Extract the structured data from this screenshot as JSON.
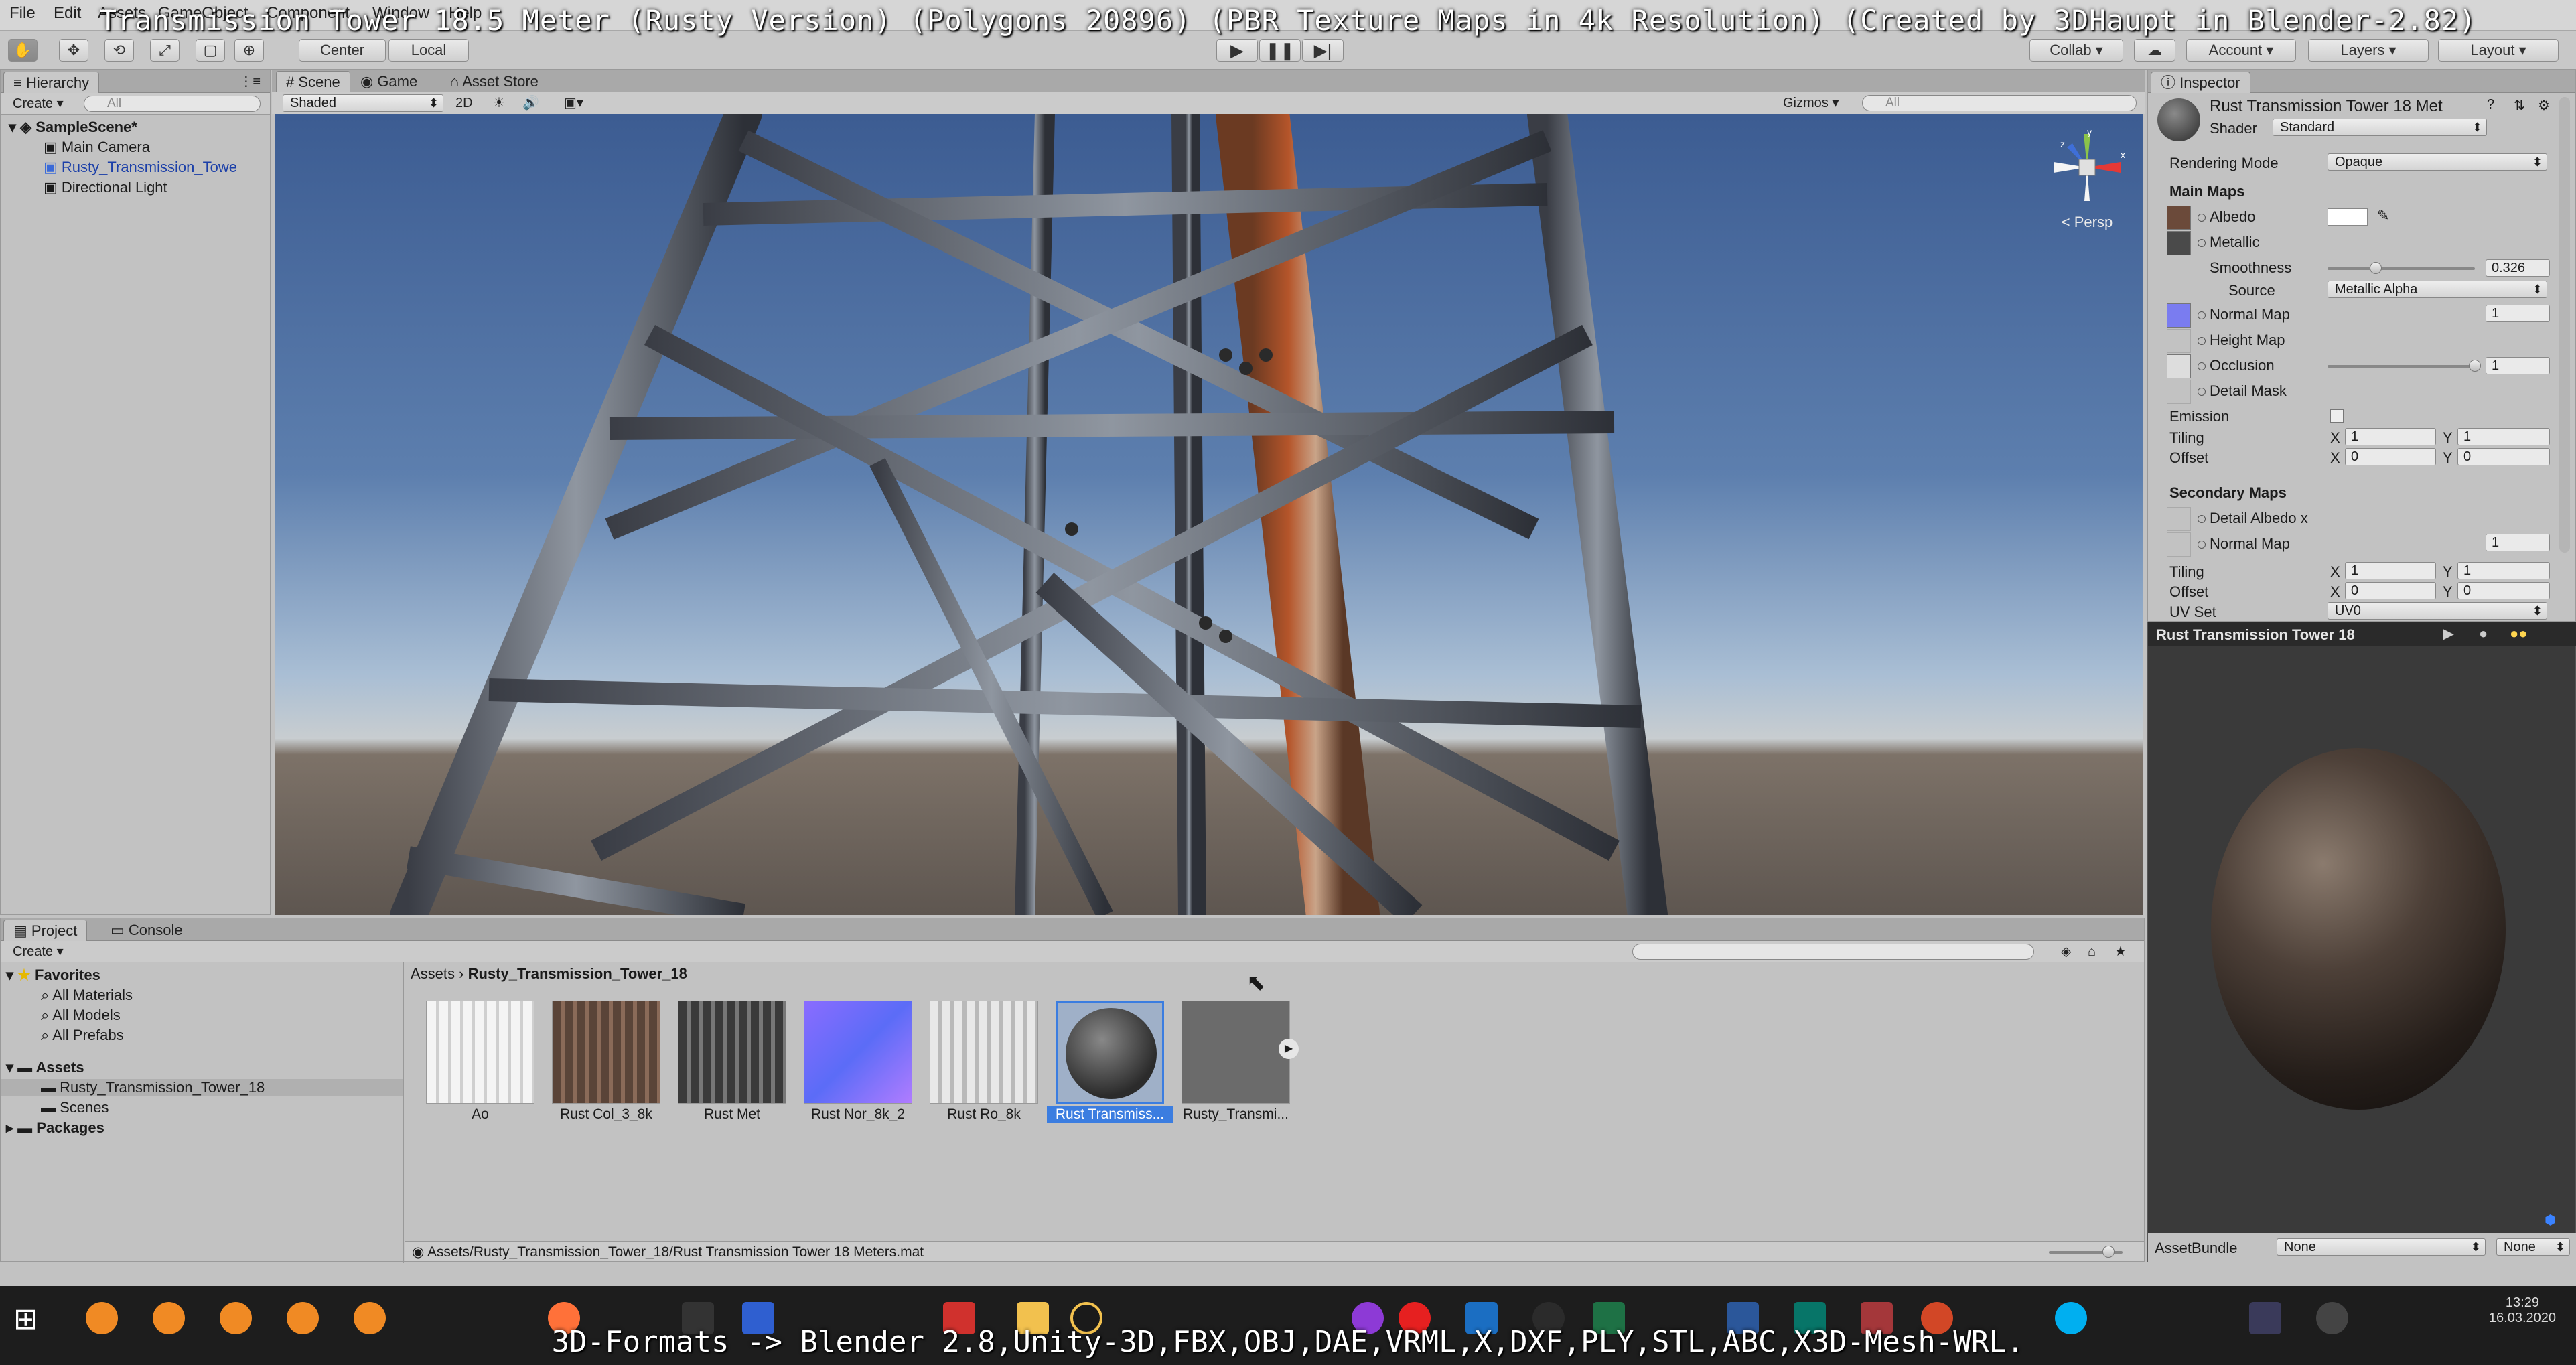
{
  "overlay": {
    "title": "Transmission Tower 18.5 Meter (Rusty Version) (Polygons 20896) (PBR Texture Maps in 4k Resolution) (Created by 3DHaupt in Blender-2.82)",
    "footer": "3D-Formats -> Blender 2.8,Unity-3D,FBX,OBJ,DAE,VRML,X,DXF,PLY,STL,ABC,X3D-Mesh-WRL."
  },
  "menu": {
    "file": "File",
    "edit": "Edit",
    "assets": "Assets",
    "gameobject": "GameObject",
    "component": "Component",
    "window": "Window",
    "help": "Help"
  },
  "toolbar": {
    "pivot_center": "Center",
    "pivot_local": "Local",
    "collab": "Collab",
    "account": "Account",
    "layers": "Layers",
    "layout": "Layout"
  },
  "hierarchy": {
    "tab": "Hierarchy",
    "create": "Create",
    "search_placeholder": "All",
    "scene": "SampleScene*",
    "items": [
      "Main Camera",
      "Rusty_Transmission_Towe",
      "Directional Light"
    ]
  },
  "scene": {
    "tabs": [
      "Scene",
      "Game",
      "Asset Store"
    ],
    "shading": "Shaded",
    "mode_2d": "2D",
    "gizmos": "Gizmos",
    "search_placeholder": "All",
    "persp": "Persp",
    "gizmo_axes": [
      "y",
      "x",
      "z"
    ]
  },
  "inspector": {
    "tab": "Inspector",
    "material_name": "Rust Transmission Tower 18 Met",
    "shader_label": "Shader",
    "shader_value": "Standard",
    "rendering_mode_label": "Rendering Mode",
    "rendering_mode_value": "Opaque",
    "main_maps": "Main Maps",
    "albedo": "Albedo",
    "metallic": "Metallic",
    "smoothness": "Smoothness",
    "smoothness_value": "0.326",
    "smoothness_fraction": 0.326,
    "source_label": "Source",
    "source_value": "Metallic Alpha",
    "normal_map": "Normal Map",
    "normal_value": "1",
    "height_map": "Height Map",
    "occlusion": "Occlusion",
    "occlusion_value": "1",
    "occlusion_fraction": 1.0,
    "detail_mask": "Detail Mask",
    "emission": "Emission",
    "tiling": "Tiling",
    "offset": "Offset",
    "x_label": "X",
    "y_label": "Y",
    "main_tiling_x": "1",
    "main_tiling_y": "1",
    "main_offset_x": "0",
    "main_offset_y": "0",
    "secondary_maps": "Secondary Maps",
    "detail_albedo": "Detail Albedo x",
    "sec_normal_map": "Normal Map",
    "sec_normal_value": "1",
    "sec_tiling_x": "1",
    "sec_tiling_y": "1",
    "sec_offset_x": "0",
    "sec_offset_y": "0",
    "uv_set_label": "UV Set",
    "uv_set_value": "UV0",
    "preview_title": "Rust Transmission Tower 18",
    "assetbundle_label": "AssetBundle",
    "assetbundle_value": "None",
    "assetbundle_variant": "None"
  },
  "project": {
    "tabs": [
      "Project",
      "Console"
    ],
    "create": "Create",
    "favorites": "Favorites",
    "favorite_items": [
      "All Materials",
      "All Models",
      "All Prefabs"
    ],
    "assets": "Assets",
    "asset_folders": [
      "Rusty_Transmission_Tower_18",
      "Scenes"
    ],
    "packages": "Packages",
    "breadcrumb_root": "Assets",
    "breadcrumb_folder": "Rusty_Transmission_Tower_18",
    "asset_labels": [
      "Ao",
      "Rust Col_3_8k",
      "Rust Met",
      "Rust Nor_8k_2",
      "Rust Ro_8k",
      "Rust Transmiss...",
      "Rusty_Transmi..."
    ],
    "status_path": "Assets/Rusty_Transmission_Tower_18/Rust Transmission Tower 18 Meters.mat"
  },
  "taskbar": {
    "time": "13:29",
    "date": "16.03.2020"
  },
  "colors": {
    "selected_text": "#1b3fa8",
    "normal_map_swatch": "#7a7cf0",
    "taskbar_bg": "#1d1d1d"
  }
}
